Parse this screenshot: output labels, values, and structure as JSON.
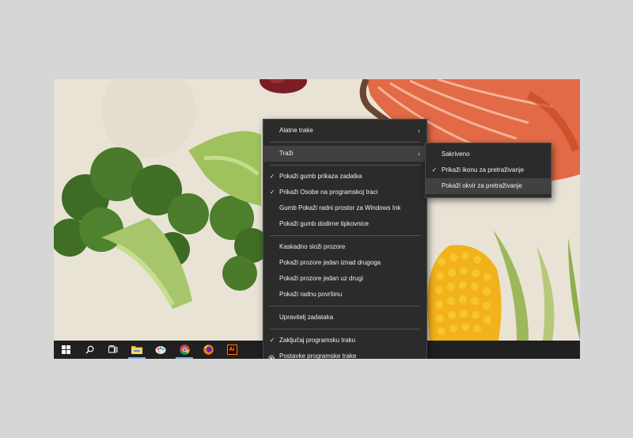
{
  "context_menu": {
    "items": [
      {
        "label": "Alatne trake",
        "submenu": true
      },
      {
        "label": "Traži",
        "submenu": true,
        "highlighted": true
      },
      {
        "label": "Pokaži gumb prikaza zadatka",
        "checked": true
      },
      {
        "label": "Prikaži Osobe na programskoj traci",
        "checked": true
      },
      {
        "label": "Gumb Pokaži radni prostor za Windows Ink"
      },
      {
        "label": "Pokaži gumb dodirne tipkovnice"
      },
      {
        "label": "Kaskadno složi prozore"
      },
      {
        "label": "Pokaži prozore jedan iznad drugoga"
      },
      {
        "label": "Pokaži prozore jedan uz drugi"
      },
      {
        "label": "Pokaži radnu površinu"
      },
      {
        "label": "Upravitelj zadataka"
      },
      {
        "label": "Zaključaj programsku traku",
        "checked": true
      },
      {
        "label": "Postavke programske trake",
        "icon": "gear-icon"
      }
    ]
  },
  "search_submenu": {
    "items": [
      {
        "label": "Sakriveno"
      },
      {
        "label": "Prikaži ikonu za pretraživanje",
        "checked": true
      },
      {
        "label": "Pokaži okvir za pretraživanje",
        "highlighted": true
      }
    ]
  },
  "taskbar": {
    "icons": [
      "windows-start-icon",
      "search-icon",
      "task-view-icon",
      "file-explorer-icon",
      "paint-app-icon",
      "chrome-icon",
      "firefox-icon",
      "illustrator-icon"
    ],
    "illustrator_label": "Ai"
  },
  "colors": {
    "taskbar": "#202020",
    "menu_bg": "#2b2b2b",
    "menu_highlight": "#414141",
    "active_indicator": "#7fb3e0"
  }
}
